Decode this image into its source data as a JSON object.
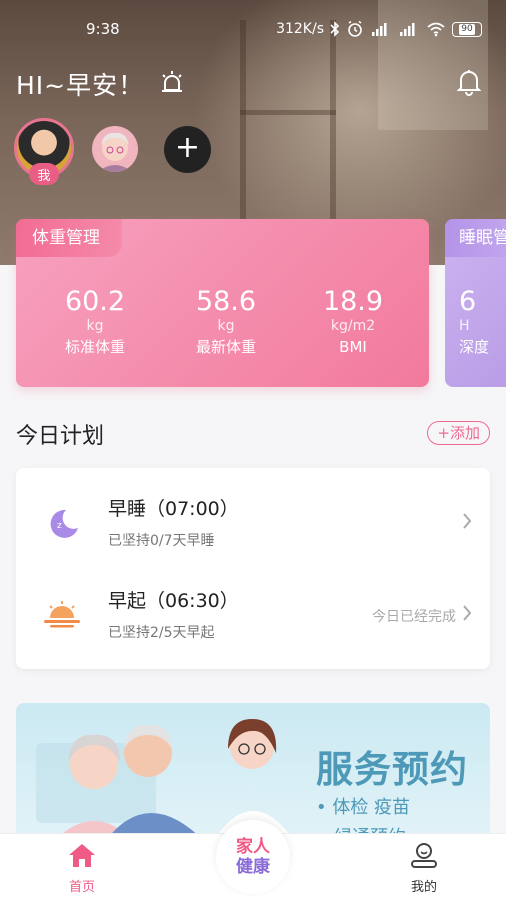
{
  "status_bar": {
    "time": "9:38",
    "speed": "312K/s",
    "battery": "90"
  },
  "header": {
    "greeting": "HI~早安！",
    "me_badge": "我"
  },
  "weight_card": {
    "title": "体重管理",
    "metrics": [
      {
        "value": "60.2",
        "unit": "kg",
        "label": "标准体重"
      },
      {
        "value": "58.6",
        "unit": "kg",
        "label": "最新体重"
      },
      {
        "value": "18.9",
        "unit": "kg/m2",
        "label": "BMI"
      }
    ]
  },
  "sleep_card": {
    "title": "睡眠管",
    "value": "6",
    "unit": "H",
    "label": "深度"
  },
  "plan": {
    "title": "今日计划",
    "add_label": "添加",
    "items": [
      {
        "title": "早睡（07:00）",
        "sub": "已坚持0/7天早睡",
        "status": ""
      },
      {
        "title": "早起（06:30）",
        "sub": "已坚持2/5天早起",
        "status": "今日已经完成"
      }
    ]
  },
  "banner": {
    "title": "服务预约",
    "items": [
      "• 体检 疫苗",
      "绿通预约"
    ]
  },
  "tabbar": {
    "home": "首页",
    "center_line1": "家人",
    "center_line2": "健康",
    "mine": "我的"
  },
  "colors": {
    "accent": "#ef6a90",
    "tab_active": "#ef5b85",
    "plan_blue": "#4e99b8"
  }
}
